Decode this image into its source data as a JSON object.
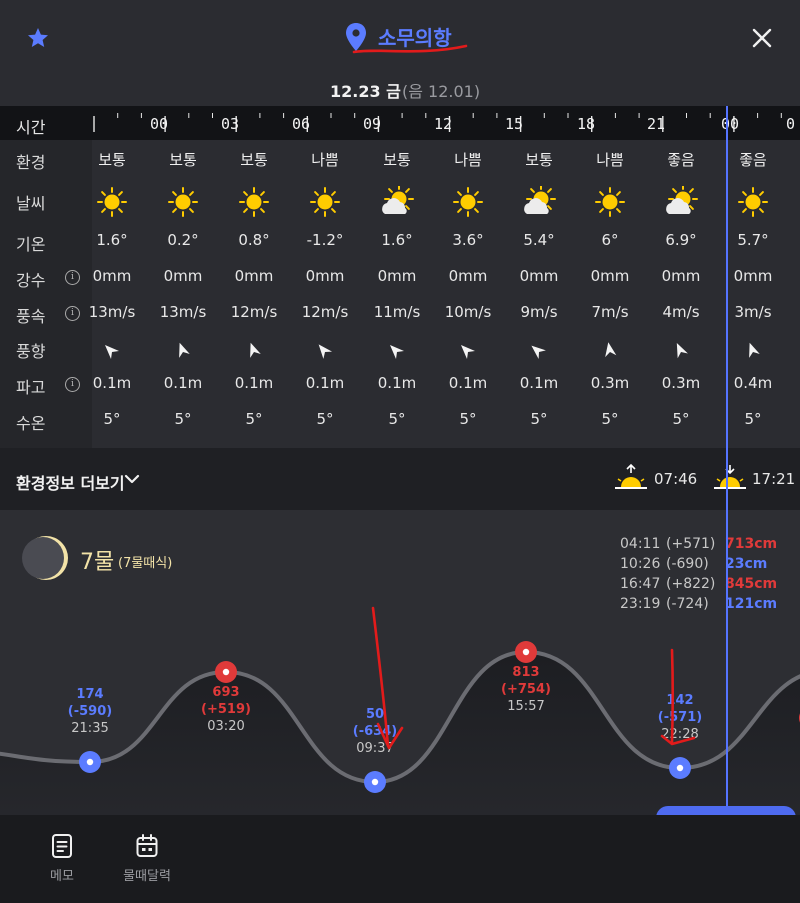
{
  "header": {
    "location": "소무의항",
    "date_main": "12.23 금",
    "date_lunar": "(음 12.01)"
  },
  "ruler": {
    "label": "시간",
    "hours": [
      "00",
      "03",
      "06",
      "09",
      "12",
      "15",
      "18",
      "21",
      "00",
      "0"
    ]
  },
  "rows": {
    "env": "환경",
    "weather": "날씨",
    "temp": "기온",
    "precip": "강수",
    "wind_speed": "풍속",
    "wind_dir": "풍향",
    "wave": "파고",
    "water_temp": "수온"
  },
  "columns": [
    {
      "env": "보통",
      "weather": "sunny",
      "temp": "1.6°",
      "precip": "0mm",
      "wind": "13m/s",
      "wind_dir_deg": 225,
      "wave": "0.1m",
      "water": "5°"
    },
    {
      "env": "보통",
      "weather": "sunny",
      "temp": "0.2°",
      "precip": "0mm",
      "wind": "13m/s",
      "wind_dir_deg": 250,
      "wave": "0.1m",
      "water": "5°"
    },
    {
      "env": "보통",
      "weather": "sunny",
      "temp": "0.8°",
      "precip": "0mm",
      "wind": "12m/s",
      "wind_dir_deg": 250,
      "wave": "0.1m",
      "water": "5°"
    },
    {
      "env": "나쁨",
      "weather": "sunny",
      "temp": "-1.2°",
      "precip": "0mm",
      "wind": "12m/s",
      "wind_dir_deg": 230,
      "wave": "0.1m",
      "water": "5°"
    },
    {
      "env": "보통",
      "weather": "partly-cloudy",
      "temp": "1.6°",
      "precip": "0mm",
      "wind": "11m/s",
      "wind_dir_deg": 225,
      "wave": "0.1m",
      "water": "5°"
    },
    {
      "env": "나쁨",
      "weather": "sunny",
      "temp": "3.6°",
      "precip": "0mm",
      "wind": "10m/s",
      "wind_dir_deg": 225,
      "wave": "0.1m",
      "water": "5°"
    },
    {
      "env": "보통",
      "weather": "partly-cloudy",
      "temp": "5.4°",
      "precip": "0mm",
      "wind": "9m/s",
      "wind_dir_deg": 220,
      "wave": "0.1m",
      "water": "5°"
    },
    {
      "env": "나쁨",
      "weather": "sunny",
      "temp": "6°",
      "precip": "0mm",
      "wind": "7m/s",
      "wind_dir_deg": 260,
      "wave": "0.3m",
      "water": "5°"
    },
    {
      "env": "좋음",
      "weather": "partly-cloudy",
      "temp": "6.9°",
      "precip": "0mm",
      "wind": "4m/s",
      "wind_dir_deg": 245,
      "wave": "0.3m",
      "water": "5°"
    },
    {
      "env": "좋음",
      "weather": "sunny",
      "temp": "5.7°",
      "precip": "0mm",
      "wind": "3m/s",
      "wind_dir_deg": 250,
      "wave": "0.4m",
      "water": "5°"
    }
  ],
  "more_bar": {
    "label": "환경정보 더보기",
    "sunrise": "07:46",
    "sunset": "17:21"
  },
  "tide": {
    "mul": "7물",
    "mul_sub": "(7물때식)",
    "list": [
      {
        "time": "04:11",
        "diff": "(+571)",
        "height": "713cm",
        "kind": "high"
      },
      {
        "time": "10:26",
        "diff": "(-690)",
        "height": "23cm",
        "kind": "low"
      },
      {
        "time": "16:47",
        "diff": "(+822)",
        "height": "845cm",
        "kind": "high"
      },
      {
        "time": "23:19",
        "diff": "(-724)",
        "height": "121cm",
        "kind": "low"
      }
    ],
    "points": [
      {
        "value": "174",
        "diff": "(-590)",
        "time": "21:35",
        "kind": "low"
      },
      {
        "value": "693",
        "diff": "(+519)",
        "time": "03:20",
        "kind": "high"
      },
      {
        "value": "50",
        "diff": "(-634)",
        "time": "09:37",
        "kind": "low"
      },
      {
        "value": "813",
        "diff": "(+754)",
        "time": "15:57",
        "kind": "high"
      },
      {
        "value": "142",
        "diff": "(-571)",
        "time": "22:28",
        "kind": "low"
      }
    ],
    "colors": {
      "high": "#e03a3a",
      "low": "#5b7cff"
    }
  },
  "bottom_nav": {
    "memo": "메모",
    "calendar": "물때달력"
  }
}
